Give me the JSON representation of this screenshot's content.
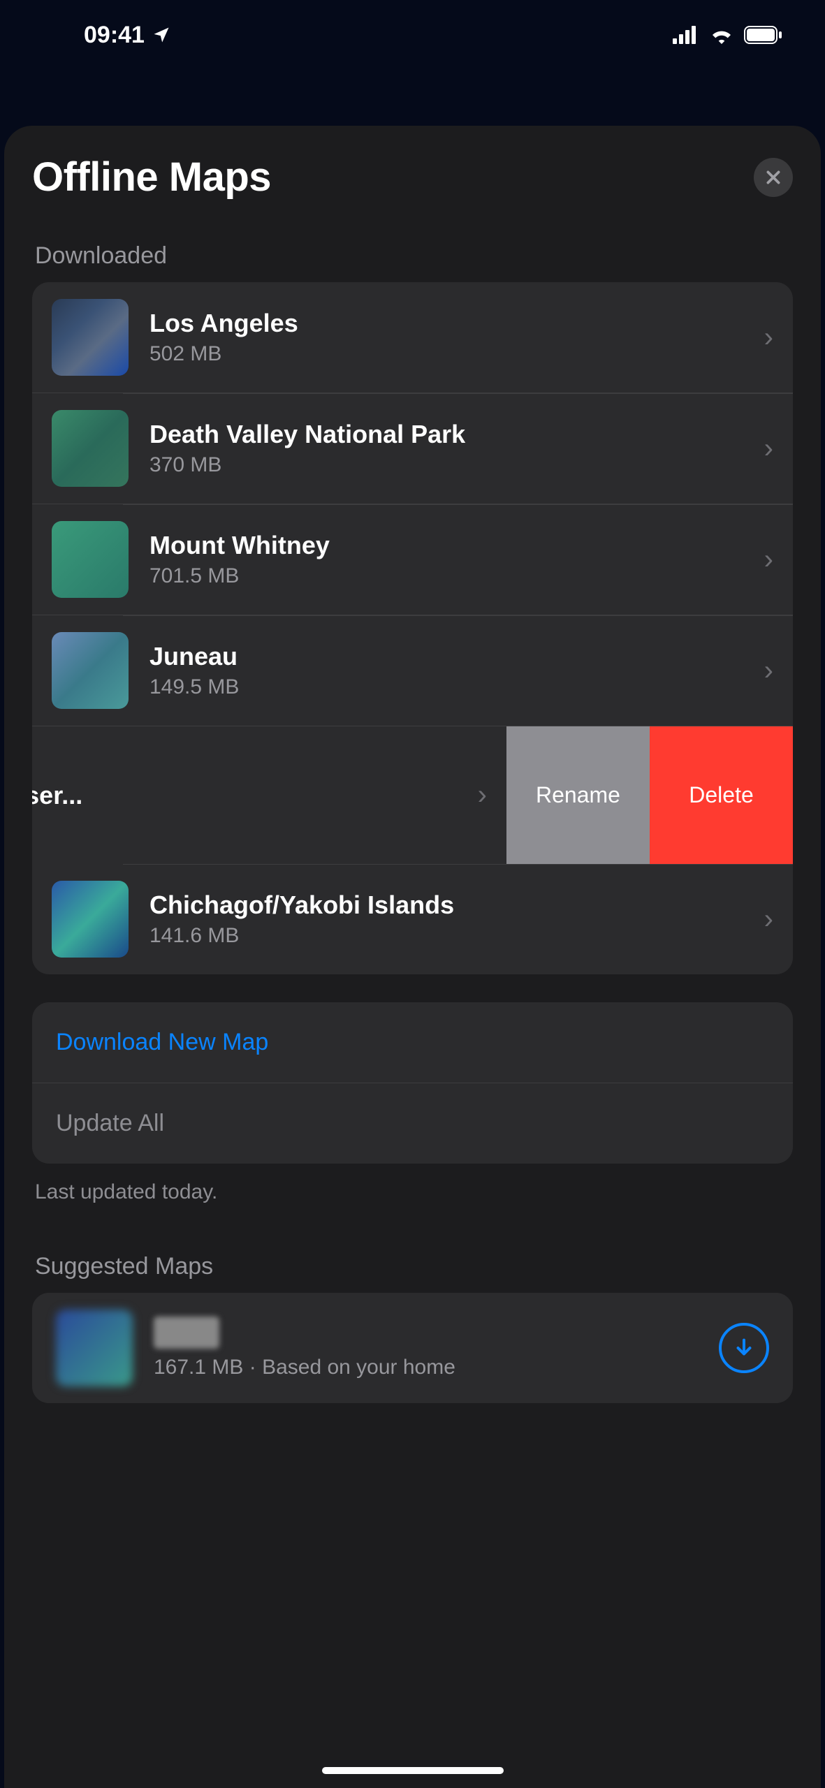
{
  "status": {
    "time": "09:41"
  },
  "sheet": {
    "title": "Offline Maps"
  },
  "downloaded": {
    "label": "Downloaded",
    "items": [
      {
        "name": "Los Angeles",
        "size": "502 MB"
      },
      {
        "name": "Death Valley National Park",
        "size": "370 MB"
      },
      {
        "name": "Mount Whitney",
        "size": "701.5 MB"
      },
      {
        "name": "Juneau",
        "size": "149.5 MB"
      },
      {
        "name": "y National Park & Preser...",
        "size": ""
      },
      {
        "name": "Chichagof/Yakobi Islands",
        "size": "141.6 MB"
      }
    ]
  },
  "swipe": {
    "rename": "Rename",
    "delete": "Delete"
  },
  "actions": {
    "download_new": "Download New Map",
    "update_all": "Update All",
    "last_updated": "Last updated today."
  },
  "suggested": {
    "label": "Suggested Maps",
    "item": {
      "sub": "167.1 MB · Based on your home"
    }
  }
}
